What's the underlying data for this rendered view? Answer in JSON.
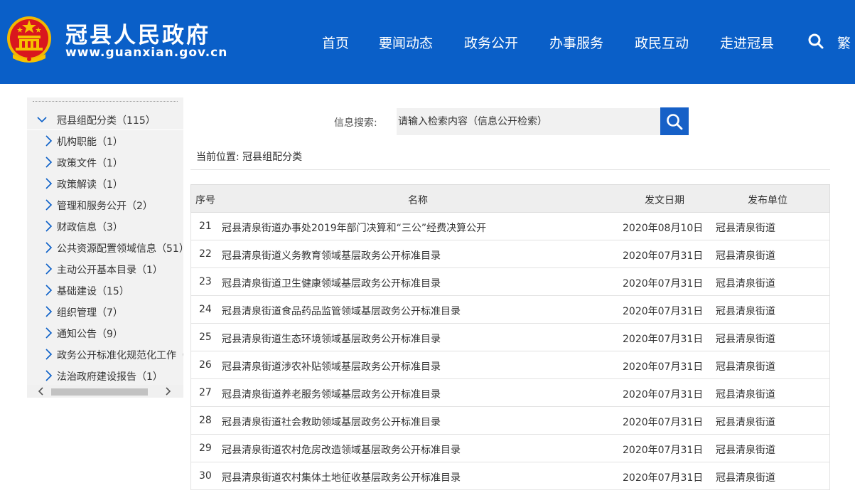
{
  "header": {
    "site_title": "冠县人民政府",
    "site_url": "www.guanxian.gov.cn",
    "nav": [
      "首页",
      "要闻动态",
      "政务公开",
      "办事服务",
      "政民互动",
      "走进冠县"
    ],
    "lang_toggle": "繁",
    "brand_color": "#0a5fc8"
  },
  "sidebar": {
    "root": {
      "label": "冠县组配分类（115）",
      "expanded": true
    },
    "items": [
      "机构职能（1）",
      "政策文件（1）",
      "政策解读（1）",
      "管理和服务公开（2）",
      "财政信息（3）",
      "公共资源配置领域信息（51）",
      "主动公开基本目录（1）",
      "基础建设（15）",
      "组织管理（7）",
      "通知公告（9）",
      "政务公开标准化规范化工作（",
      "法治政府建设报告（1）"
    ]
  },
  "search": {
    "label": "信息搜索:",
    "placeholder": "请输入检索内容（信息公开检索）"
  },
  "breadcrumb": "当前位置: 冠县组配分类",
  "table": {
    "columns": [
      "序号",
      "名称",
      "发文日期",
      "发布单位"
    ],
    "rows": [
      {
        "no": "21",
        "title": "冠县清泉街道办事处2019年部门决算和“三公”经费决算公开",
        "date": "2020年08月10日",
        "org": "冠县清泉街道"
      },
      {
        "no": "22",
        "title": "冠县清泉街道义务教育领域基层政务公开标准目录",
        "date": "2020年07月31日",
        "org": "冠县清泉街道"
      },
      {
        "no": "23",
        "title": "冠县清泉街道卫生健康领域基层政务公开标准目录",
        "date": "2020年07月31日",
        "org": "冠县清泉街道"
      },
      {
        "no": "24",
        "title": "冠县清泉街道食品药品监管领域基层政务公开标准目录",
        "date": "2020年07月31日",
        "org": "冠县清泉街道"
      },
      {
        "no": "25",
        "title": "冠县清泉街道生态环境领域基层政务公开标准目录",
        "date": "2020年07月31日",
        "org": "冠县清泉街道"
      },
      {
        "no": "26",
        "title": "冠县清泉街道涉农补贴领域基层政务公开标准目录",
        "date": "2020年07月31日",
        "org": "冠县清泉街道"
      },
      {
        "no": "27",
        "title": "冠县清泉街道养老服务领域基层政务公开标准目录",
        "date": "2020年07月31日",
        "org": "冠县清泉街道"
      },
      {
        "no": "28",
        "title": "冠县清泉街道社会救助领域基层政务公开标准目录",
        "date": "2020年07月31日",
        "org": "冠县清泉街道"
      },
      {
        "no": "29",
        "title": "冠县清泉街道农村危房改造领域基层政务公开标准目录",
        "date": "2020年07月31日",
        "org": "冠县清泉街道"
      },
      {
        "no": "30",
        "title": "冠县清泉街道农村集体土地征收基层政务公开标准目录",
        "date": "2020年07月31日",
        "org": "冠县清泉街道"
      }
    ]
  }
}
